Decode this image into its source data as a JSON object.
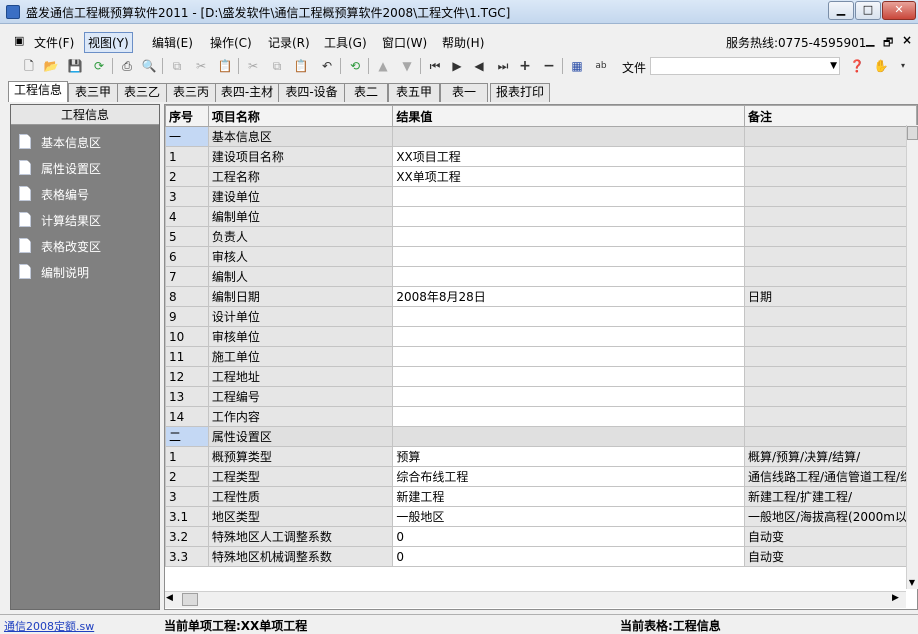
{
  "window": {
    "title": "盛发通信工程概预算软件2011 - [D:\\盛发软件\\通信工程概预算软件2008\\工程文件\\1.TGC]",
    "min_glyph": "▁",
    "max_glyph": "□",
    "close_glyph": "✕"
  },
  "menubar": {
    "items": [
      {
        "label": "文件(F)"
      },
      {
        "label": "视图(Y)"
      },
      {
        "label": "编辑(E)"
      },
      {
        "label": "操作(C)"
      },
      {
        "label": "记录(R)"
      },
      {
        "label": "工具(G)"
      },
      {
        "label": "窗口(W)"
      },
      {
        "label": "帮助(H)"
      }
    ],
    "selected": "视图(Y)",
    "hotline": "服务热线:0775-4595901",
    "mdi_min": "▁",
    "mdi_restore": "🗗",
    "mdi_close": "×"
  },
  "toolbar": {
    "icons": [
      "new-icon",
      "open-icon",
      "save-icon",
      "refresh-green-icon",
      "print-icon",
      "print-preview-icon",
      "copy-icon",
      "cut-icon",
      "paste-icon",
      "cut2-icon",
      "copy2-icon",
      "paste2-icon",
      "undo-icon",
      "recalc-icon",
      "up-icon",
      "down-icon",
      "first-icon",
      "next-icon",
      "prev-icon",
      "last-icon",
      "add-icon",
      "remove-icon",
      "table-edit-icon",
      "spellcheck-icon"
    ],
    "file_label": "文件",
    "file_value": "",
    "help_icon": "help-icon",
    "hand_icon": "hand-icon"
  },
  "tabs": [
    {
      "label": "工程信息",
      "active": true
    },
    {
      "label": "表三甲"
    },
    {
      "label": "表三乙"
    },
    {
      "label": "表三丙"
    },
    {
      "label": "表四-主材"
    },
    {
      "label": "表四-设备"
    },
    {
      "label": "表二"
    },
    {
      "label": "表五甲"
    },
    {
      "label": "表一"
    },
    {
      "label": "报表打印"
    }
  ],
  "leftpanel": {
    "title": "工程信息",
    "items": [
      {
        "label": "基本信息区"
      },
      {
        "label": "属性设置区"
      },
      {
        "label": "表格编号"
      },
      {
        "label": "计算结果区"
      },
      {
        "label": "表格改变区"
      },
      {
        "label": "编制说明"
      }
    ]
  },
  "grid": {
    "columns": [
      "序号",
      "项目名称",
      "结果值",
      "备注"
    ],
    "rows": [
      {
        "seq": "一",
        "name": "基本信息区",
        "value": "",
        "note": "",
        "section": true
      },
      {
        "seq": "1",
        "name": "建设项目名称",
        "value": "XX项目工程",
        "note": ""
      },
      {
        "seq": "2",
        "name": "工程名称",
        "value": "XX单项工程",
        "note": ""
      },
      {
        "seq": "3",
        "name": "建设单位",
        "value": "",
        "note": ""
      },
      {
        "seq": "4",
        "name": "编制单位",
        "value": "",
        "note": ""
      },
      {
        "seq": "5",
        "name": "负责人",
        "value": "",
        "note": ""
      },
      {
        "seq": "6",
        "name": "审核人",
        "value": "",
        "note": ""
      },
      {
        "seq": "7",
        "name": "编制人",
        "value": "",
        "note": ""
      },
      {
        "seq": "8",
        "name": "编制日期",
        "value": "2008年8月28日",
        "note": "日期"
      },
      {
        "seq": "9",
        "name": "设计单位",
        "value": "",
        "note": ""
      },
      {
        "seq": "10",
        "name": "审核单位",
        "value": "",
        "note": ""
      },
      {
        "seq": "11",
        "name": "施工单位",
        "value": "",
        "note": ""
      },
      {
        "seq": "12",
        "name": "工程地址",
        "value": "",
        "note": ""
      },
      {
        "seq": "13",
        "name": "工程编号",
        "value": "",
        "note": ""
      },
      {
        "seq": "14",
        "name": "工作内容",
        "value": "",
        "note": ""
      },
      {
        "seq": "二",
        "name": "属性设置区",
        "value": "",
        "note": "",
        "section": true
      },
      {
        "seq": "1",
        "name": "概预算类型",
        "value": "预算",
        "note": "概算/预算/决算/结算/"
      },
      {
        "seq": "2",
        "name": "工程类型",
        "value": "综合布线工程",
        "note": "通信线路工程/通信管道工程/综"
      },
      {
        "seq": "3",
        "name": "工程性质",
        "value": "新建工程",
        "note": "新建工程/扩建工程/"
      },
      {
        "seq": "3.1",
        "name": "地区类型",
        "value": "一般地区",
        "note": "一般地区/海拔高程(2000m以"
      },
      {
        "seq": "3.2",
        "name": "特殊地区人工调整系数",
        "value": "0",
        "note": "自动变"
      },
      {
        "seq": "3.3",
        "name": "特殊地区机械调整系数",
        "value": "0",
        "note": "自动变"
      }
    ]
  },
  "statusbar": {
    "db": "通信2008定额.sw",
    "project": "当前单项工程:XX单项工程",
    "table": "当前表格:工程信息"
  }
}
